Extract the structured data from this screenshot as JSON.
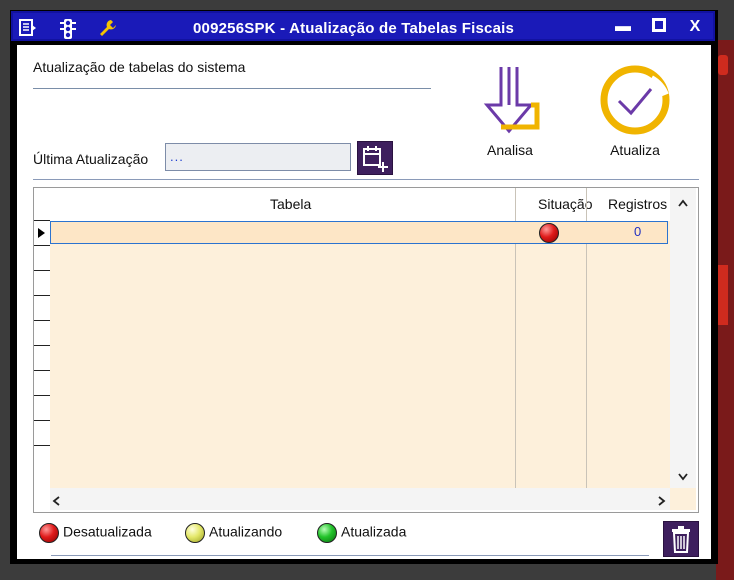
{
  "window": {
    "title": "009256SPK - Atualização de Tabelas Fiscais",
    "controls": {
      "minimize": "▬",
      "maximize": "□",
      "close": "X"
    },
    "title_icons": [
      "menu-icon",
      "traffic-light-icon",
      "wrench-icon"
    ]
  },
  "header": {
    "section_label": "Atualização de tabelas do sistema",
    "last_update_label": "Última Atualização",
    "last_update_value": "...",
    "analisa_label": "Analisa",
    "atualiza_label": "Atualiza"
  },
  "grid": {
    "columns": [
      "Tabela",
      "Situação",
      "Registros"
    ],
    "rows": [
      {
        "tabela": "",
        "situacao": "red",
        "registros": "0"
      }
    ],
    "scroll_up": "⌃",
    "scroll_down": "⌄",
    "scroll_left": "<",
    "scroll_right": ">"
  },
  "legend": {
    "desatualizada": "Desatualizada",
    "atualizando": "Atualizando",
    "atualizada": "Atualizada"
  },
  "colors": {
    "titlebar": "#1a1ab8",
    "grid_body": "#fdf0db",
    "selected_row": "#fde6c6",
    "purple_button": "#3e1f5e",
    "accent_purple": "#6b3aa8",
    "accent_gold": "#f0b400"
  }
}
